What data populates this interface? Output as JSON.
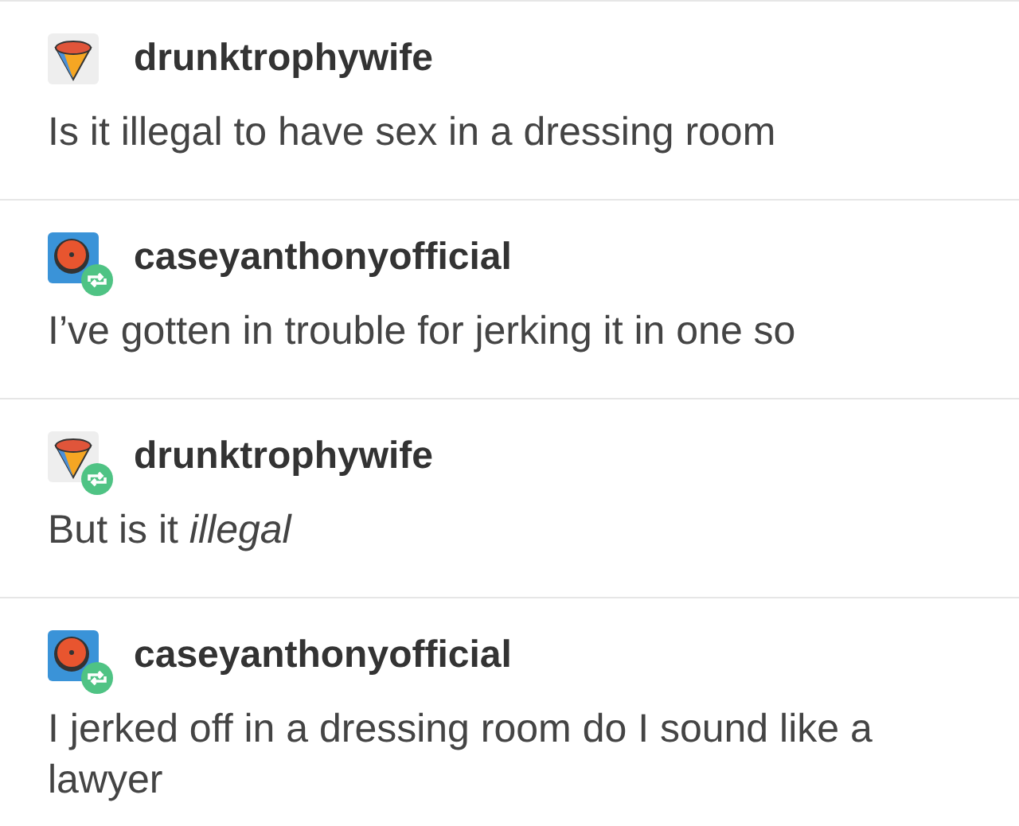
{
  "posts": [
    {
      "username": "drunktrophywife",
      "avatar": {
        "kind": "cone"
      },
      "reblogged": false,
      "text": "Is it illegal to have sex in a dressing room"
    },
    {
      "username": "caseyanthonyofficial",
      "avatar": {
        "kind": "record"
      },
      "reblogged": true,
      "text": "I’ve gotten in trouble for jerking it in one so"
    },
    {
      "username": "drunktrophywife",
      "avatar": {
        "kind": "cone"
      },
      "reblogged": true,
      "text": "But is it *illegal*"
    },
    {
      "username": "caseyanthonyofficial",
      "avatar": {
        "kind": "record"
      },
      "reblogged": true,
      "text": "I jerked off in a dressing room do I sound like a lawyer"
    }
  ]
}
